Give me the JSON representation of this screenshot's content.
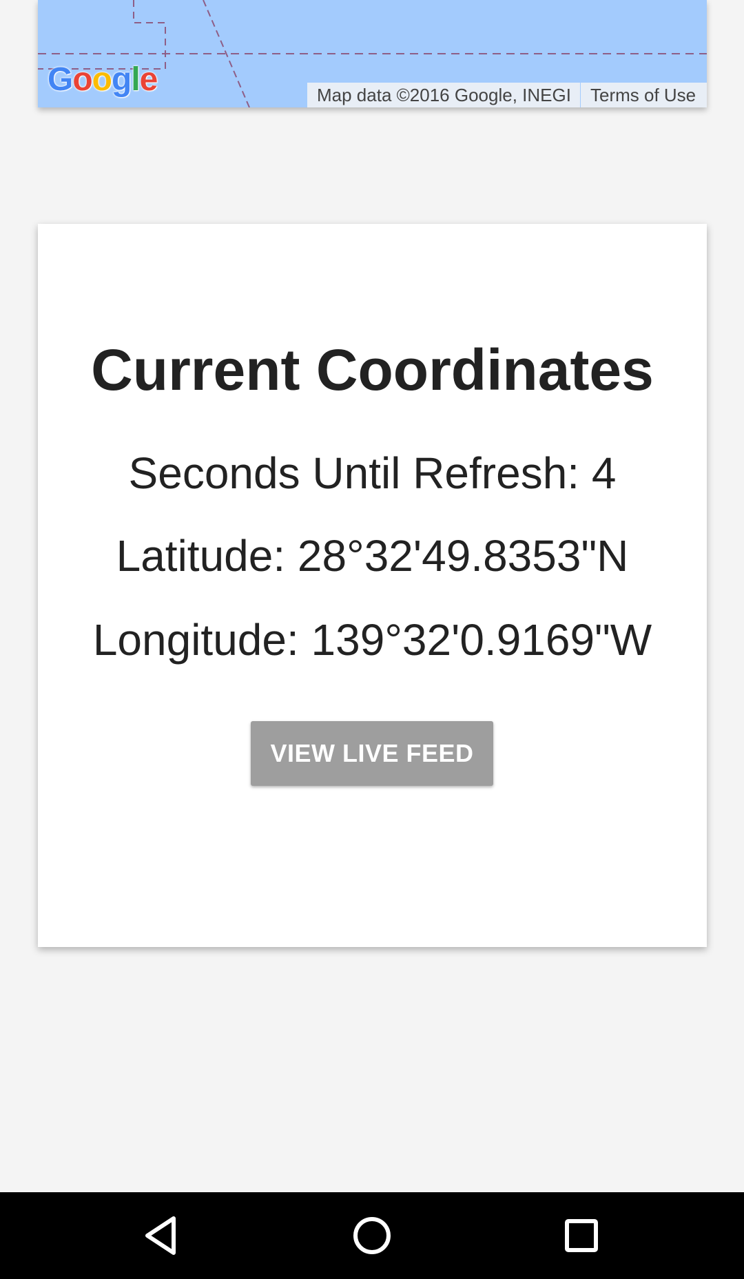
{
  "map": {
    "logo_letters": [
      {
        "char": "G",
        "color": "#4285f4"
      },
      {
        "char": "o",
        "color": "#ea4335"
      },
      {
        "char": "o",
        "color": "#fbbc05"
      },
      {
        "char": "g",
        "color": "#4285f4"
      },
      {
        "char": "l",
        "color": "#34a853"
      },
      {
        "char": "e",
        "color": "#ea4335"
      }
    ],
    "attribution": "Map data ©2016 Google, INEGI",
    "terms_link": "Terms of Use",
    "water_color": "#a3cbfd",
    "border_color": "#8e5e86"
  },
  "coordinates": {
    "title": "Current Coordinates",
    "refresh_text": "Seconds Until Refresh: 4",
    "latitude_text": "Latitude: 28°32'49.8353\"N",
    "longitude_text": "Longitude: 139°32'0.9169\"W",
    "button_label": "VIEW LIVE FEED"
  },
  "nav": {
    "back_icon": "back-triangle-icon",
    "home_icon": "home-circle-icon",
    "recent_icon": "recent-apps-square-icon"
  }
}
